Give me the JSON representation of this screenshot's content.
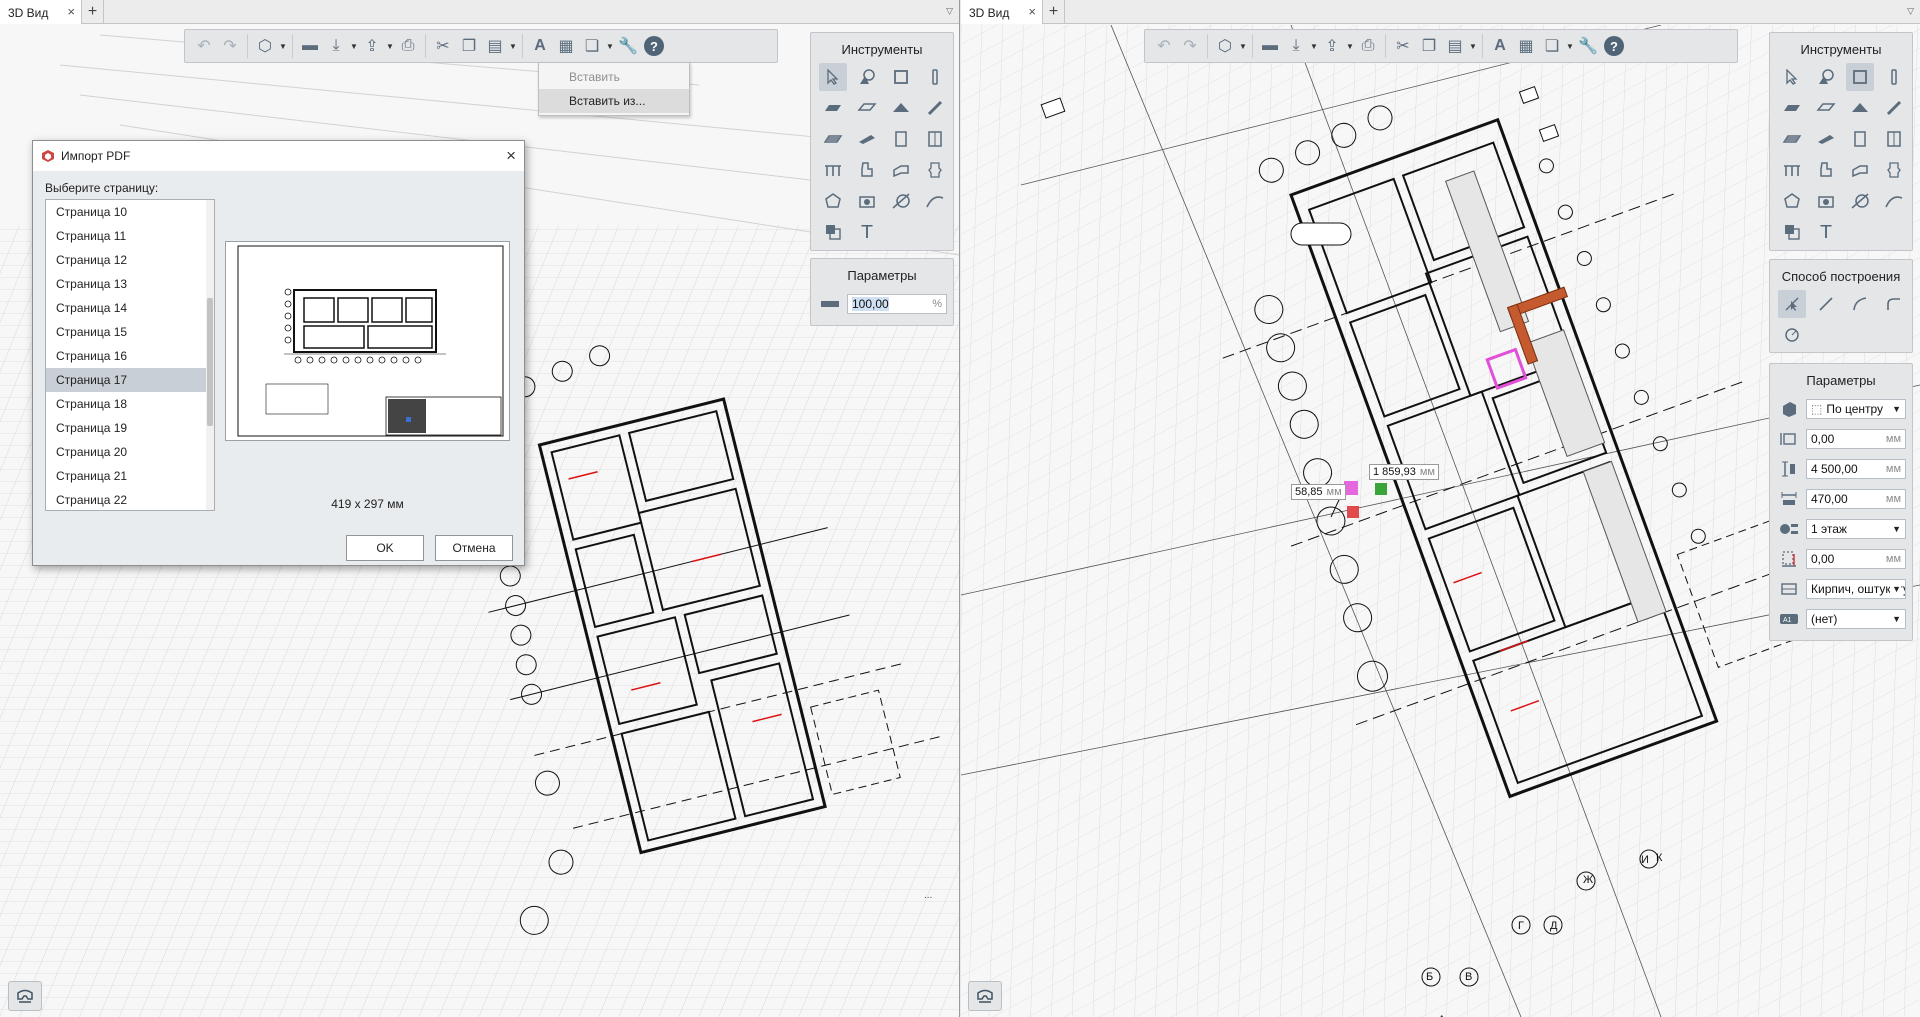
{
  "left_pane": {
    "tab": {
      "title": "3D Вид",
      "close": "×",
      "add": "+",
      "menu": "▽"
    },
    "dropdown": {
      "items": [
        "Вставить",
        "Вставить из..."
      ]
    },
    "tools_panel": {
      "title": "Инструменты"
    },
    "params_panel": {
      "title": "Параметры",
      "opacity_value": "100,00",
      "opacity_unit": "%"
    }
  },
  "right_pane": {
    "tab": {
      "title": "3D Вид",
      "close": "×",
      "add": "+",
      "menu": "▽"
    },
    "tools_panel": {
      "title": "Инструменты"
    },
    "method_panel": {
      "title": "Способ построения"
    },
    "params_panel": {
      "title": "Параметры",
      "alignment": "По центру",
      "offset": "0,00",
      "height": "4 500,00",
      "thickness": "470,00",
      "floor": "1 этаж",
      "base_offset": "0,00",
      "material": "Кирпич, оштукатуренный",
      "mark": "(нет)",
      "unit": "мм"
    },
    "dimension_labels": {
      "length": "1 859,93",
      "length_unit": "мм",
      "offset": "58,85",
      "offset_unit": "мм"
    }
  },
  "dialog": {
    "title": "Импорт PDF",
    "close": "×",
    "label": "Выберите страницу:",
    "pages": [
      "Страница 10",
      "Страница 11",
      "Страница 12",
      "Страница 13",
      "Страница 14",
      "Страница 15",
      "Страница 16",
      "Страница 17",
      "Страница 18",
      "Страница 19",
      "Страница 20",
      "Страница 21",
      "Страница 22"
    ],
    "selected_page": "Страница 17",
    "size": "419 x 297 мм",
    "ok": "OK",
    "cancel": "Отмена"
  },
  "colors": {
    "accent_selection": "#c9cfd6",
    "wall_highlight": "#d98a6a",
    "selection_magenta": "#e24fd9",
    "icon": "#5b6c7c"
  }
}
